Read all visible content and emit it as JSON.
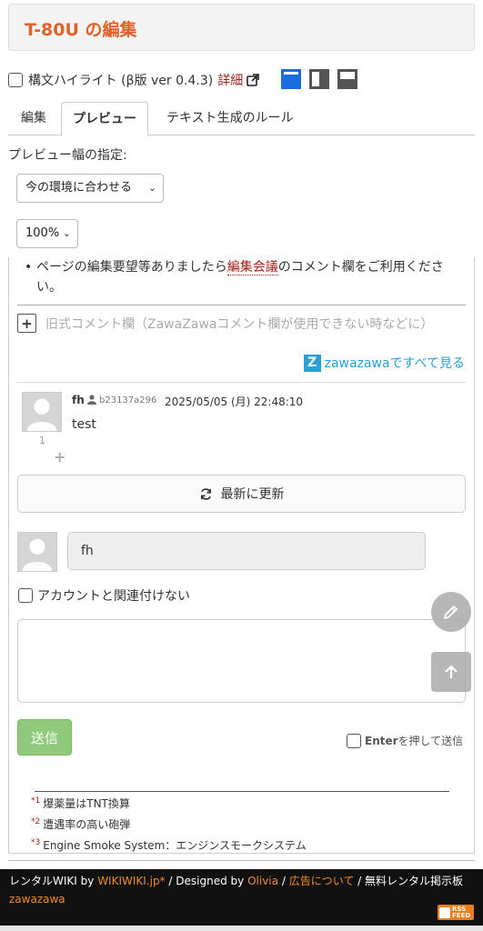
{
  "page": {
    "title": "T-80U の編集"
  },
  "syntax": {
    "label": "構文ハイライト (β版 ver 0.4.3)",
    "detail_link": "詳細"
  },
  "tabs": [
    {
      "label": "編集"
    },
    {
      "label": "プレビュー"
    },
    {
      "label": "テキスト生成のルール"
    }
  ],
  "preview_width": {
    "label": "プレビュー幅の指定:",
    "selected": "今の環境に合わせる",
    "zoom": "100%"
  },
  "content": {
    "bullet_pre": "ページの編集要望等ありましたら",
    "bullet_link": "編集会議",
    "bullet_post": "のコメント欄をご利用ください。",
    "old_comment_label": "旧式コメント欄（ZawaZawaコメント欄が使用できない時などに）",
    "zawa_link": "zawazawaですべて見る"
  },
  "comment": {
    "name": "fh",
    "user_id": "b23137a296",
    "date": "2025/05/05 (月) 22:48:10",
    "text": "test",
    "count": "1",
    "plus": "+"
  },
  "form": {
    "refresh_label": "最新に更新",
    "name_value": "fh",
    "no_account_label": "アカウントと関連付けない",
    "send_label": "送信",
    "enter_bold": "Enter",
    "enter_rest": "を押して送信"
  },
  "footnotes": [
    {
      "mark": "*1",
      "text": "爆薬量はTNT換算"
    },
    {
      "mark": "*2",
      "text": "遭遇率の高い砲弾"
    },
    {
      "mark": "*3",
      "text": "Engine Smoke System：エンジンスモークシステム"
    }
  ],
  "footer": {
    "rental_prefix": "レンタルWIKI by",
    "wikiwiki": "WIKIWIKI.jp*",
    "sep1": "/",
    "designed_by": "Designed by",
    "olivia": "Olivia",
    "sep2": "/",
    "ad": "広告について",
    "sep3": "/",
    "free_board": "無料レンタル掲示板",
    "zawazawa": "zawazawa",
    "rss_line1": "RSS",
    "rss_line2": "FEED"
  },
  "icons": {
    "external_link": "external-link-icon",
    "layout_full": "layout-full-icon",
    "layout_split_v": "layout-split-vertical-icon",
    "layout_split_h": "layout-split-horizontal-icon",
    "refresh": "refresh-icon",
    "pencil": "pencil-icon",
    "arrow_up": "arrow-up-icon"
  },
  "colors": {
    "title": "#e0622a",
    "link": "#a0201b",
    "zawa": "#2a9fd8",
    "send": "#8fc97b",
    "footer_bg": "#111111",
    "footer_accent": "#f08c2f"
  }
}
